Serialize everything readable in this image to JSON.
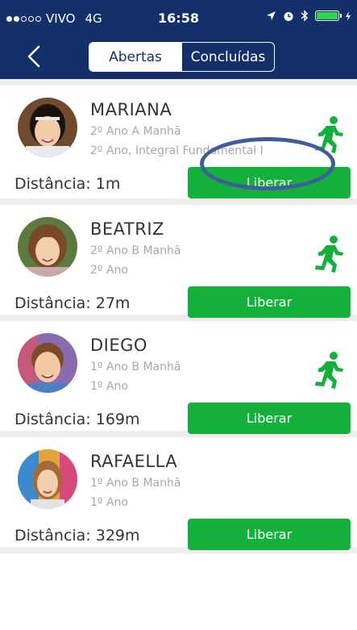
{
  "status_bar": {
    "carrier": "VIVO",
    "network": "4G",
    "time": "16:58"
  },
  "nav": {
    "tabs": [
      "Abertas",
      "Concluídas"
    ],
    "active_tab": "Abertas"
  },
  "students": [
    {
      "name": "MARIANA",
      "line1": "2º Ano A Manhã",
      "line2": "2º Ano, Integral Fundamental I",
      "distance": "Distância: 1m",
      "button": "Liberar",
      "moving": true,
      "highlighted": true
    },
    {
      "name": "BEATRIZ",
      "line1": "2º Ano B Manhã",
      "line2": "2º Ano",
      "distance": "Distância: 27m",
      "button": "Liberar",
      "moving": true
    },
    {
      "name": "DIEGO",
      "line1": "1º Ano B Manhã",
      "line2": "1º Ano",
      "distance": "Distância: 169m",
      "button": "Liberar",
      "moving": true
    },
    {
      "name": "RAFAELLA",
      "line1": "1º Ano B Manhã",
      "line2": "1º Ano",
      "distance": "Distância: 329m",
      "button": "Liberar",
      "moving": false
    }
  ],
  "colors": {
    "header": "#13306a",
    "button": "#13b13b",
    "runner_icon": "#13b13b",
    "highlight_oval": "#3f5d9c"
  }
}
